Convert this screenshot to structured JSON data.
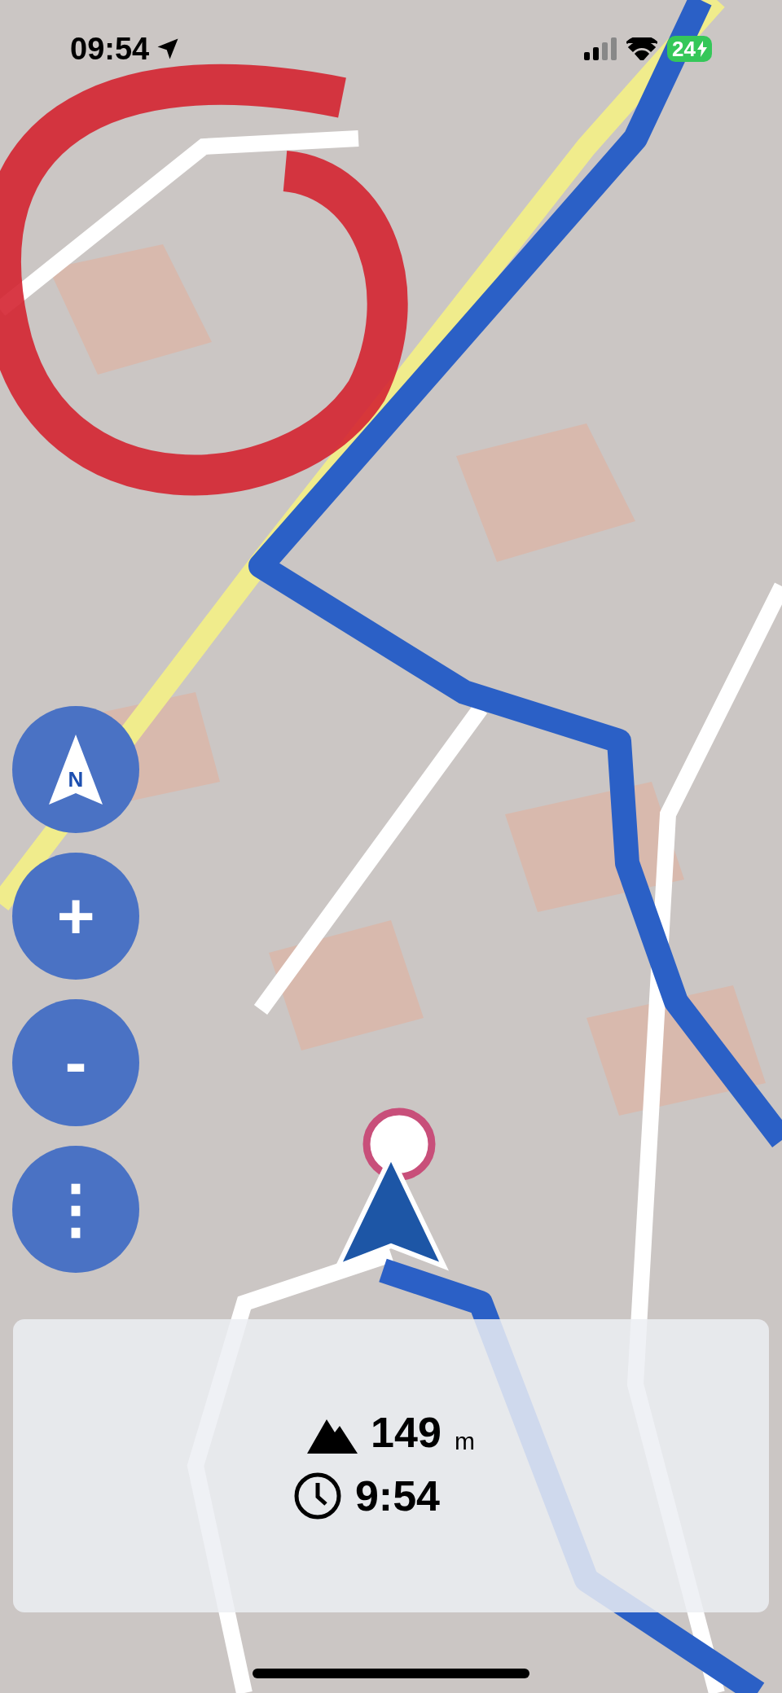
{
  "status_bar": {
    "time": "09:54",
    "battery": "24",
    "charging": true
  },
  "map_buttons": [
    {
      "kind": "compass",
      "label": "N"
    },
    {
      "kind": "text",
      "label": "+"
    },
    {
      "kind": "text",
      "label": "-"
    },
    {
      "kind": "text",
      "label": "⋮"
    }
  ],
  "info_panel": {
    "elevation": {
      "value": "149",
      "unit": "m"
    },
    "time": {
      "value": "9:54"
    }
  }
}
